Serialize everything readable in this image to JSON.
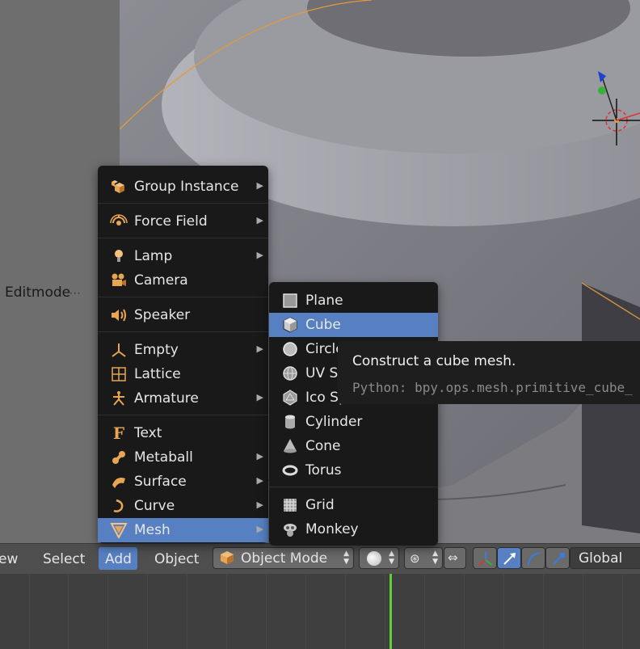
{
  "viewport": {
    "mode_label": "Editmode",
    "mode_label_trailing": "···"
  },
  "add_menu": {
    "items": [
      {
        "label": "Group Instance",
        "icon": "group-instance-icon",
        "submenu": true
      },
      {
        "label": "Force Field",
        "icon": "force-field-icon",
        "submenu": true
      },
      {
        "label": "Lamp",
        "icon": "lamp-icon",
        "submenu": true
      },
      {
        "label": "Camera",
        "icon": "camera-icon",
        "submenu": false
      },
      {
        "label": "Speaker",
        "icon": "speaker-icon",
        "submenu": false
      },
      {
        "label": "Empty",
        "icon": "empty-icon",
        "submenu": true
      },
      {
        "label": "Lattice",
        "icon": "lattice-icon",
        "submenu": false
      },
      {
        "label": "Armature",
        "icon": "armature-icon",
        "submenu": true
      },
      {
        "label": "Text",
        "icon": "text-icon",
        "submenu": false
      },
      {
        "label": "Metaball",
        "icon": "metaball-icon",
        "submenu": true
      },
      {
        "label": "Surface",
        "icon": "surface-icon",
        "submenu": true
      },
      {
        "label": "Curve",
        "icon": "curve-icon",
        "submenu": true
      },
      {
        "label": "Mesh",
        "icon": "mesh-icon",
        "submenu": true,
        "highlighted": true
      }
    ],
    "submenu_arrow": "▶"
  },
  "mesh_submenu": {
    "items": [
      {
        "label": "Plane",
        "icon": "plane-icon"
      },
      {
        "label": "Cube",
        "icon": "cube-icon",
        "highlighted": true
      },
      {
        "label": "Circle",
        "icon": "circle-icon"
      },
      {
        "label": "UV Sphere",
        "icon": "uv-sphere-icon"
      },
      {
        "label": "Ico Sphere",
        "icon": "ico-sphere-icon"
      },
      {
        "label": "Cylinder",
        "icon": "cylinder-icon"
      },
      {
        "label": "Cone",
        "icon": "cone-icon"
      },
      {
        "label": "Torus",
        "icon": "torus-icon"
      },
      {
        "label": "Grid",
        "icon": "grid-icon"
      },
      {
        "label": "Monkey",
        "icon": "monkey-icon"
      }
    ]
  },
  "tooltip": {
    "title": "Construct a cube mesh.",
    "python": "Python: bpy.ops.mesh.primitive_cube_"
  },
  "header": {
    "menus": [
      "ew",
      "Select",
      "Add",
      "Object"
    ],
    "active_menu": "Add",
    "mode_select": "Object Mode",
    "transform_orientation": "Global"
  },
  "colors": {
    "highlight": "#5680c2",
    "menu_bg": "#191919",
    "playhead": "#5fcf3a",
    "icon_orange": "#e8a552"
  }
}
